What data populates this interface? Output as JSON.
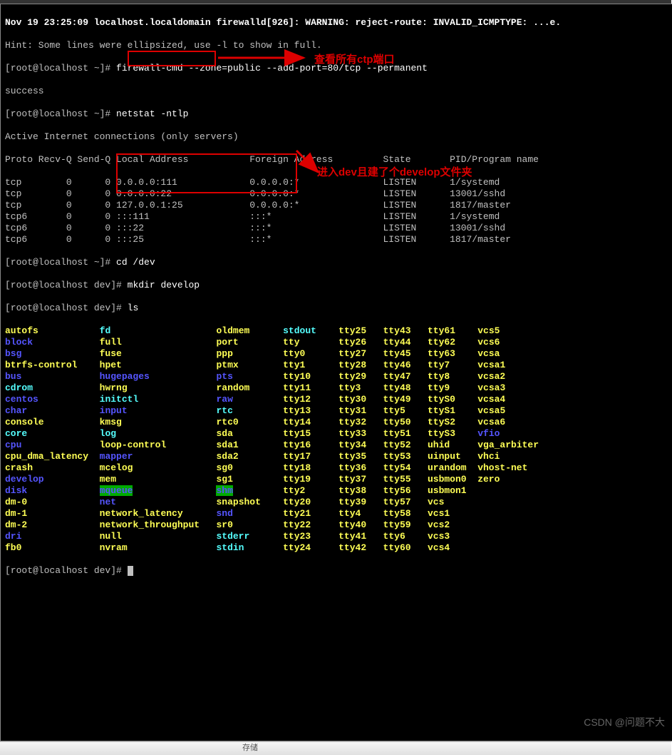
{
  "titlebar": {},
  "log": {
    "line0": "Nov 19 23:25:09 localhost.localdomain firewalld[926]: WARNING: reject-route: INVALID_ICMPTYPE: ...e.",
    "hint": "Hint: Some lines were ellipsized, use -l to show in full."
  },
  "cmds": {
    "prompt1": "[root@localhost ~]# ",
    "cmd1": "firewall-cmd --zone=public --add-port=80/tcp --permanent",
    "out1": "success",
    "prompt2": "[root@localhost ~]# ",
    "cmd2": "netstat -ntlp",
    "out2": "Active Internet connections (only servers)",
    "header": {
      "proto": "Proto",
      "recvq": "Recv-Q",
      "sendq": "Send-Q",
      "local": "Local Address",
      "foreign": "Foreign Address",
      "state": "State",
      "pid": "PID/Program name"
    },
    "rows": [
      {
        "p": "tcp",
        "r": "0",
        "s": "0",
        "l": "0.0.0.0:111",
        "f": "0.0.0.0:*",
        "st": "LISTEN",
        "pg": "1/systemd"
      },
      {
        "p": "tcp",
        "r": "0",
        "s": "0",
        "l": "0.0.0.0:22",
        "f": "0.0.0.0:*",
        "st": "LISTEN",
        "pg": "13001/sshd"
      },
      {
        "p": "tcp",
        "r": "0",
        "s": "0",
        "l": "127.0.0.1:25",
        "f": "0.0.0.0:*",
        "st": "LISTEN",
        "pg": "1817/master"
      },
      {
        "p": "tcp6",
        "r": "0",
        "s": "0",
        "l": ":::111",
        "f": ":::*",
        "st": "LISTEN",
        "pg": "1/systemd"
      },
      {
        "p": "tcp6",
        "r": "0",
        "s": "0",
        "l": ":::22",
        "f": ":::*",
        "st": "LISTEN",
        "pg": "13001/sshd"
      },
      {
        "p": "tcp6",
        "r": "0",
        "s": "0",
        "l": ":::25",
        "f": ":::*",
        "st": "LISTEN",
        "pg": "1817/master"
      }
    ],
    "prompt3": "[root@localhost ~]# ",
    "cmd3": "cd /dev",
    "prompt4": "[root@localhost dev]# ",
    "cmd4": "mkdir develop",
    "prompt5": "[root@localhost dev]# ",
    "cmd5": "ls",
    "prompt6": "[root@localhost dev]# "
  },
  "annotations": {
    "a1": "查看所有ctp端口",
    "a2": "进入dev且建了个develop文件夹"
  },
  "ls_rows": [
    [
      {
        "t": "autofs",
        "c": "ltyellow"
      },
      {
        "t": "fd",
        "c": "ltcyan"
      },
      {
        "t": "oldmem",
        "c": "ltyellow"
      },
      {
        "t": "stdout",
        "c": "ltcyan"
      },
      {
        "t": "tty25",
        "c": "ltyellow"
      },
      {
        "t": "tty43",
        "c": "ltyellow"
      },
      {
        "t": "tty61",
        "c": "ltyellow"
      },
      {
        "t": "vcs5",
        "c": "ltyellow"
      }
    ],
    [
      {
        "t": "block",
        "c": "ltblue"
      },
      {
        "t": "full",
        "c": "ltyellow"
      },
      {
        "t": "port",
        "c": "ltyellow"
      },
      {
        "t": "tty",
        "c": "ltyellow"
      },
      {
        "t": "tty26",
        "c": "ltyellow"
      },
      {
        "t": "tty44",
        "c": "ltyellow"
      },
      {
        "t": "tty62",
        "c": "ltyellow"
      },
      {
        "t": "vcs6",
        "c": "ltyellow"
      }
    ],
    [
      {
        "t": "bsg",
        "c": "ltblue"
      },
      {
        "t": "fuse",
        "c": "ltyellow"
      },
      {
        "t": "ppp",
        "c": "ltyellow"
      },
      {
        "t": "tty0",
        "c": "ltyellow"
      },
      {
        "t": "tty27",
        "c": "ltyellow"
      },
      {
        "t": "tty45",
        "c": "ltyellow"
      },
      {
        "t": "tty63",
        "c": "ltyellow"
      },
      {
        "t": "vcsa",
        "c": "ltyellow"
      }
    ],
    [
      {
        "t": "btrfs-control",
        "c": "ltyellow"
      },
      {
        "t": "hpet",
        "c": "ltyellow"
      },
      {
        "t": "ptmx",
        "c": "ltyellow"
      },
      {
        "t": "tty1",
        "c": "ltyellow"
      },
      {
        "t": "tty28",
        "c": "ltyellow"
      },
      {
        "t": "tty46",
        "c": "ltyellow"
      },
      {
        "t": "tty7",
        "c": "ltyellow"
      },
      {
        "t": "vcsa1",
        "c": "ltyellow"
      }
    ],
    [
      {
        "t": "bus",
        "c": "ltblue"
      },
      {
        "t": "hugepages",
        "c": "ltblue"
      },
      {
        "t": "pts",
        "c": "ltblue"
      },
      {
        "t": "tty10",
        "c": "ltyellow"
      },
      {
        "t": "tty29",
        "c": "ltyellow"
      },
      {
        "t": "tty47",
        "c": "ltyellow"
      },
      {
        "t": "tty8",
        "c": "ltyellow"
      },
      {
        "t": "vcsa2",
        "c": "ltyellow"
      }
    ],
    [
      {
        "t": "cdrom",
        "c": "ltcyan"
      },
      {
        "t": "hwrng",
        "c": "ltyellow"
      },
      {
        "t": "random",
        "c": "ltyellow"
      },
      {
        "t": "tty11",
        "c": "ltyellow"
      },
      {
        "t": "tty3",
        "c": "ltyellow"
      },
      {
        "t": "tty48",
        "c": "ltyellow"
      },
      {
        "t": "tty9",
        "c": "ltyellow"
      },
      {
        "t": "vcsa3",
        "c": "ltyellow"
      }
    ],
    [
      {
        "t": "centos",
        "c": "ltblue"
      },
      {
        "t": "initctl",
        "c": "ltcyan"
      },
      {
        "t": "raw",
        "c": "ltblue"
      },
      {
        "t": "tty12",
        "c": "ltyellow"
      },
      {
        "t": "tty30",
        "c": "ltyellow"
      },
      {
        "t": "tty49",
        "c": "ltyellow"
      },
      {
        "t": "ttyS0",
        "c": "ltyellow"
      },
      {
        "t": "vcsa4",
        "c": "ltyellow"
      }
    ],
    [
      {
        "t": "char",
        "c": "ltblue"
      },
      {
        "t": "input",
        "c": "ltblue"
      },
      {
        "t": "rtc",
        "c": "ltcyan"
      },
      {
        "t": "tty13",
        "c": "ltyellow"
      },
      {
        "t": "tty31",
        "c": "ltyellow"
      },
      {
        "t": "tty5",
        "c": "ltyellow"
      },
      {
        "t": "ttyS1",
        "c": "ltyellow"
      },
      {
        "t": "vcsa5",
        "c": "ltyellow"
      }
    ],
    [
      {
        "t": "console",
        "c": "ltyellow"
      },
      {
        "t": "kmsg",
        "c": "ltyellow"
      },
      {
        "t": "rtc0",
        "c": "ltyellow"
      },
      {
        "t": "tty14",
        "c": "ltyellow"
      },
      {
        "t": "tty32",
        "c": "ltyellow"
      },
      {
        "t": "tty50",
        "c": "ltyellow"
      },
      {
        "t": "ttyS2",
        "c": "ltyellow"
      },
      {
        "t": "vcsa6",
        "c": "ltyellow"
      }
    ],
    [
      {
        "t": "core",
        "c": "ltcyan"
      },
      {
        "t": "log",
        "c": "ltcyan"
      },
      {
        "t": "sda",
        "c": "ltyellow"
      },
      {
        "t": "tty15",
        "c": "ltyellow"
      },
      {
        "t": "tty33",
        "c": "ltyellow"
      },
      {
        "t": "tty51",
        "c": "ltyellow"
      },
      {
        "t": "ttyS3",
        "c": "ltyellow"
      },
      {
        "t": "vfio",
        "c": "ltblue"
      }
    ],
    [
      {
        "t": "cpu",
        "c": "ltblue"
      },
      {
        "t": "loop-control",
        "c": "ltyellow"
      },
      {
        "t": "sda1",
        "c": "ltyellow"
      },
      {
        "t": "tty16",
        "c": "ltyellow"
      },
      {
        "t": "tty34",
        "c": "ltyellow"
      },
      {
        "t": "tty52",
        "c": "ltyellow"
      },
      {
        "t": "uhid",
        "c": "ltyellow"
      },
      {
        "t": "vga_arbiter",
        "c": "ltyellow"
      }
    ],
    [
      {
        "t": "cpu_dma_latency",
        "c": "ltyellow"
      },
      {
        "t": "mapper",
        "c": "ltblue"
      },
      {
        "t": "sda2",
        "c": "ltyellow"
      },
      {
        "t": "tty17",
        "c": "ltyellow"
      },
      {
        "t": "tty35",
        "c": "ltyellow"
      },
      {
        "t": "tty53",
        "c": "ltyellow"
      },
      {
        "t": "uinput",
        "c": "ltyellow"
      },
      {
        "t": "vhci",
        "c": "ltyellow"
      }
    ],
    [
      {
        "t": "crash",
        "c": "ltyellow"
      },
      {
        "t": "mcelog",
        "c": "ltyellow"
      },
      {
        "t": "sg0",
        "c": "ltyellow"
      },
      {
        "t": "tty18",
        "c": "ltyellow"
      },
      {
        "t": "tty36",
        "c": "ltyellow"
      },
      {
        "t": "tty54",
        "c": "ltyellow"
      },
      {
        "t": "urandom",
        "c": "ltyellow"
      },
      {
        "t": "vhost-net",
        "c": "ltyellow"
      }
    ],
    [
      {
        "t": "develop",
        "c": "ltblue"
      },
      {
        "t": "mem",
        "c": "ltyellow"
      },
      {
        "t": "sg1",
        "c": "ltyellow"
      },
      {
        "t": "tty19",
        "c": "ltyellow"
      },
      {
        "t": "tty37",
        "c": "ltyellow"
      },
      {
        "t": "tty55",
        "c": "ltyellow"
      },
      {
        "t": "usbmon0",
        "c": "ltyellow"
      },
      {
        "t": "zero",
        "c": "ltyellow"
      }
    ],
    [
      {
        "t": "disk",
        "c": "ltblue"
      },
      {
        "t": "mqueue",
        "c": "green-bg"
      },
      {
        "t": "shm",
        "c": "green-bg"
      },
      {
        "t": "tty2",
        "c": "ltyellow"
      },
      {
        "t": "tty38",
        "c": "ltyellow"
      },
      {
        "t": "tty56",
        "c": "ltyellow"
      },
      {
        "t": "usbmon1",
        "c": "ltyellow"
      },
      {
        "t": "",
        "c": ""
      }
    ],
    [
      {
        "t": "dm-0",
        "c": "ltyellow"
      },
      {
        "t": "net",
        "c": "ltblue"
      },
      {
        "t": "snapshot",
        "c": "ltyellow"
      },
      {
        "t": "tty20",
        "c": "ltyellow"
      },
      {
        "t": "tty39",
        "c": "ltyellow"
      },
      {
        "t": "tty57",
        "c": "ltyellow"
      },
      {
        "t": "vcs",
        "c": "ltyellow"
      },
      {
        "t": "",
        "c": ""
      }
    ],
    [
      {
        "t": "dm-1",
        "c": "ltyellow"
      },
      {
        "t": "network_latency",
        "c": "ltyellow"
      },
      {
        "t": "snd",
        "c": "ltblue"
      },
      {
        "t": "tty21",
        "c": "ltyellow"
      },
      {
        "t": "tty4",
        "c": "ltyellow"
      },
      {
        "t": "tty58",
        "c": "ltyellow"
      },
      {
        "t": "vcs1",
        "c": "ltyellow"
      },
      {
        "t": "",
        "c": ""
      }
    ],
    [
      {
        "t": "dm-2",
        "c": "ltyellow"
      },
      {
        "t": "network_throughput",
        "c": "ltyellow"
      },
      {
        "t": "sr0",
        "c": "ltyellow"
      },
      {
        "t": "tty22",
        "c": "ltyellow"
      },
      {
        "t": "tty40",
        "c": "ltyellow"
      },
      {
        "t": "tty59",
        "c": "ltyellow"
      },
      {
        "t": "vcs2",
        "c": "ltyellow"
      },
      {
        "t": "",
        "c": ""
      }
    ],
    [
      {
        "t": "dri",
        "c": "ltblue"
      },
      {
        "t": "null",
        "c": "ltyellow"
      },
      {
        "t": "stderr",
        "c": "ltcyan"
      },
      {
        "t": "tty23",
        "c": "ltyellow"
      },
      {
        "t": "tty41",
        "c": "ltyellow"
      },
      {
        "t": "tty6",
        "c": "ltyellow"
      },
      {
        "t": "vcs3",
        "c": "ltyellow"
      },
      {
        "t": "",
        "c": ""
      }
    ],
    [
      {
        "t": "fb0",
        "c": "ltyellow"
      },
      {
        "t": "nvram",
        "c": "ltyellow"
      },
      {
        "t": "stdin",
        "c": "ltcyan"
      },
      {
        "t": "tty24",
        "c": "ltyellow"
      },
      {
        "t": "tty42",
        "c": "ltyellow"
      },
      {
        "t": "tty60",
        "c": "ltyellow"
      },
      {
        "t": "vcs4",
        "c": "ltyellow"
      },
      {
        "t": "",
        "c": ""
      }
    ]
  ],
  "bottombar": {
    "text": "存储"
  }
}
